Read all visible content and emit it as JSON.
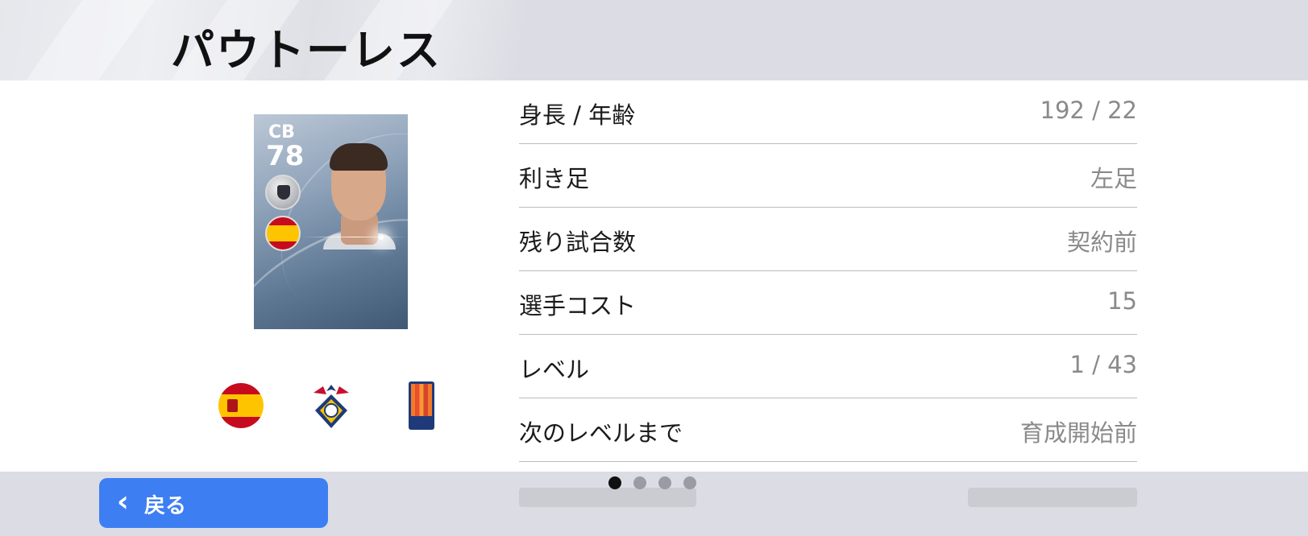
{
  "header": {
    "title": "パウトーレス"
  },
  "card": {
    "position": "CB",
    "rating": "78"
  },
  "info_rows": [
    {
      "label": "身長 / 年齢",
      "value": "192 / 22"
    },
    {
      "label": "利き足",
      "value": "左足"
    },
    {
      "label": "残り試合数",
      "value": "契約前"
    },
    {
      "label": "選手コスト",
      "value": "15"
    },
    {
      "label": "レベル",
      "value": "1 / 43"
    },
    {
      "label": "次のレベルまで",
      "value": "育成開始前"
    }
  ],
  "footer": {
    "back_label": "戻る",
    "page_count": 4,
    "active_page": 1
  },
  "colors": {
    "accent": "#3d7ff3",
    "header_bg": "#dcdde4",
    "divider": "#b9bcc4"
  },
  "icons": {
    "back": "chevron-left-icon",
    "nation": "spain-flag-icon",
    "club": "club-crest-icon",
    "league": "league-badge-icon"
  }
}
